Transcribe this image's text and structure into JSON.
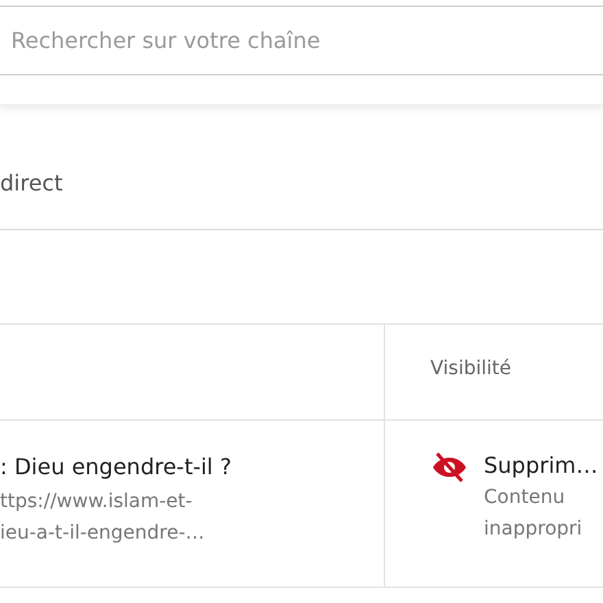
{
  "search": {
    "placeholder": "Rechercher sur votre chaîne"
  },
  "tabs": [
    {
      "label": "direct"
    }
  ],
  "table": {
    "columns": [
      "Visibilité"
    ],
    "rows": [
      {
        "title": ": Dieu engendre-t-il ?",
        "description": [
          "ttps://www.islam-et-",
          "ieu-a-t-il-engendre-…"
        ],
        "visibility": {
          "kind": "removed",
          "label": "Supprim…",
          "reason": [
            "Contenu",
            "inappropri"
          ]
        }
      }
    ]
  }
}
